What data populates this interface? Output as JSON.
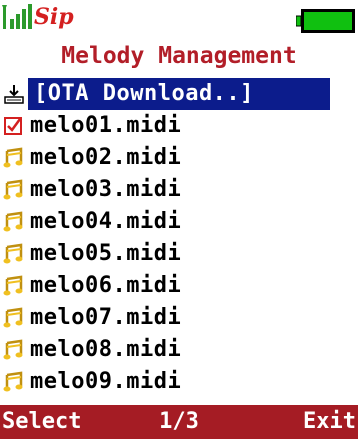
{
  "colors": {
    "accent_red": "#b21e28",
    "title_text": "#b21e28",
    "selection_bg": "#0c1c8c",
    "softkey_bg": "#a51c24",
    "battery_green": "#10c010",
    "signal_green": "#2c9a2c",
    "note_icon_yellow": "#f0c020",
    "checkbox_red": "#d42020"
  },
  "status": {
    "carrier_logo": "Sip",
    "signal_icon": "signal-bars-icon",
    "battery_icon": "battery-full-icon"
  },
  "title": "Melody Management",
  "list": {
    "items": [
      {
        "label": "[OTA Download..]",
        "icon": "download-icon",
        "selected": true
      },
      {
        "label": "melo01.midi",
        "icon": "checkbox-checked-icon",
        "selected": false
      },
      {
        "label": "melo02.midi",
        "icon": "music-note-icon",
        "selected": false
      },
      {
        "label": "melo03.midi",
        "icon": "music-note-icon",
        "selected": false
      },
      {
        "label": "melo04.midi",
        "icon": "music-note-icon",
        "selected": false
      },
      {
        "label": "melo05.midi",
        "icon": "music-note-icon",
        "selected": false
      },
      {
        "label": "melo06.midi",
        "icon": "music-note-icon",
        "selected": false
      },
      {
        "label": "melo07.midi",
        "icon": "music-note-icon",
        "selected": false
      },
      {
        "label": "melo08.midi",
        "icon": "music-note-icon",
        "selected": false
      },
      {
        "label": "melo09.midi",
        "icon": "music-note-icon",
        "selected": false
      }
    ]
  },
  "softkeys": {
    "left": "Select",
    "center": "1/3",
    "right": "Exit"
  }
}
